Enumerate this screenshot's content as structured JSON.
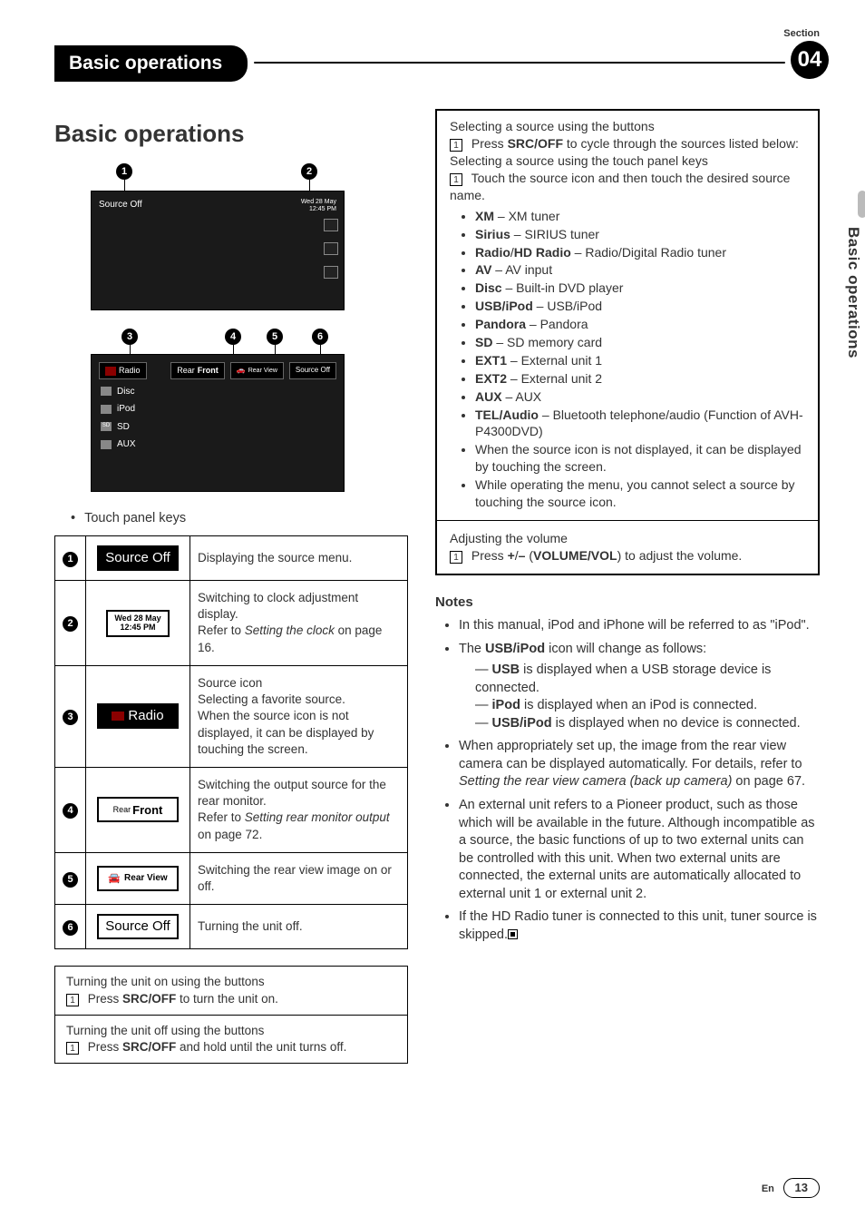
{
  "header": {
    "chapter": "Basic operations",
    "section_label": "Section",
    "section_number": "04"
  },
  "side_tab": "Basic operations",
  "title": "Basic operations",
  "fig1": {
    "source_off": "Source Off",
    "clock_day": "Wed 28 May",
    "clock_time": "12:45 PM",
    "c1": "1",
    "c2": "2"
  },
  "fig2": {
    "c3": "3",
    "c4": "4",
    "c5": "5",
    "c6": "6",
    "radio": "Radio",
    "disc": "Disc",
    "ipod": "iPod",
    "sd": "SD",
    "aux": "AUX",
    "rear": "Rear",
    "front": "Front",
    "rearview": "Rear View",
    "srcoff": "Source Off"
  },
  "touch_label": "Touch panel keys",
  "table": {
    "r1": {
      "n": "1",
      "key": "Source Off",
      "desc": "Displaying the source menu."
    },
    "r2": {
      "n": "2",
      "day": "Wed 28 May",
      "time": "12:45 PM",
      "l1": "Switching to clock adjustment display.",
      "l2a": "Refer to ",
      "l2i": "Setting the clock",
      "l2b": " on page 16."
    },
    "r3": {
      "n": "3",
      "key": "Radio",
      "l1": "Source icon",
      "l2": "Selecting a favorite source.",
      "l3": "When the source icon is not displayed, it can be displayed by touching the screen."
    },
    "r4": {
      "n": "4",
      "rear": "Rear",
      "front": "Front",
      "l1": "Switching the output source for the rear monitor.",
      "l2a": "Refer to ",
      "l2i": "Setting rear monitor output",
      "l2b": " on page 72."
    },
    "r5": {
      "n": "5",
      "key": "Rear View",
      "desc": "Switching the rear view image on or off."
    },
    "r6": {
      "n": "6",
      "key": "Source Off",
      "desc": "Turning the unit off."
    }
  },
  "inst": {
    "on_t": "Turning the unit on using the buttons",
    "on_s": "Press ",
    "on_b": "SRC/OFF",
    "on_e": " to turn the unit on.",
    "off_t": "Turning the unit off using the buttons",
    "off_s": "Press ",
    "off_b": "SRC/OFF",
    "off_e": " and hold until the unit turns off.",
    "step": "1"
  },
  "right": {
    "sel_btn_t": "Selecting a source using the buttons",
    "sel_btn_s": "Press ",
    "sel_btn_b": "SRC/OFF",
    "sel_btn_e": " to cycle through the sources listed below:",
    "sel_tp_t": "Selecting a source using the touch panel keys",
    "sel_tp_s": "Touch the source icon and then touch the desired source name.",
    "sources": {
      "xm_b": "XM",
      "xm_d": " – XM tuner",
      "sir_b": "Sirius",
      "sir_d": " – SIRIUS tuner",
      "rad_b": "Radio",
      "rad_sep": "/",
      "rad_b2": "HD Radio",
      "rad_d": " – Radio/Digital Radio tuner",
      "av_b": "AV",
      "av_d": " – AV input",
      "disc_b": "Disc",
      "disc_d": " – Built-in DVD player",
      "usb_b": "USB/iPod",
      "usb_d": " – USB/iPod",
      "pan_b": "Pandora",
      "pan_d": " – Pandora",
      "sd_b": "SD",
      "sd_d": " – SD memory card",
      "e1_b": "EXT1",
      "e1_d": " – External unit 1",
      "e2_b": "EXT2",
      "e2_d": " – External unit 2",
      "aux_b": "AUX",
      "aux_d": " – AUX",
      "tel_b": "TEL/Audio",
      "tel_d": " – Bluetooth telephone/audio (Function of AVH-P4300DVD)"
    },
    "note1": "When the source icon is not displayed, it can be displayed by touching the screen.",
    "note2": "While operating the menu, you cannot select a source by touching the source icon.",
    "vol_t": "Adjusting the volume",
    "vol_s": "Press ",
    "vol_b1": "+",
    "vol_sep": "/",
    "vol_b2": "–",
    "vol_paren_a": " (",
    "vol_b3": "VOLUME/VOL",
    "vol_paren_b": ") to adjust the volume."
  },
  "notes": {
    "h": "Notes",
    "n1": "In this manual, iPod and iPhone will be referred to as \"iPod\".",
    "n2a": "The ",
    "n2b": "USB/iPod",
    "n2c": " icon will change as follows:",
    "s1a": "USB",
    "s1b": " is displayed when a USB storage device is connected.",
    "s2a": "iPod",
    "s2b": " is displayed when an iPod is connected.",
    "s3a": "USB/iPod",
    "s3b": " is displayed when no device is connected.",
    "n3a": "When appropriately set up, the image from the rear view camera can be displayed automatically. For details, refer to ",
    "n3i": "Setting the rear view camera (back up camera)",
    "n3b": " on page 67.",
    "n4": "An external unit refers to a Pioneer product, such as those which will be available in the future. Although incompatible as a source, the basic functions of up to two external units can be controlled with this unit. When two external units are connected, the external units are automatically allocated to external unit 1 or external unit 2.",
    "n5": "If the HD Radio tuner is connected to this unit, tuner source is skipped."
  },
  "footer": {
    "en": "En",
    "page": "13"
  }
}
